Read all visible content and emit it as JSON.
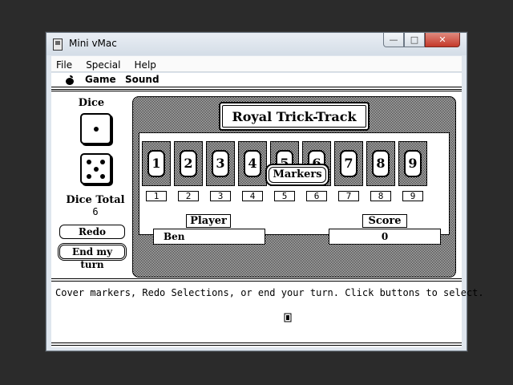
{
  "host_window": {
    "title": "Mini vMac",
    "menu": [
      "File",
      "Special",
      "Help"
    ],
    "controls": {
      "minimize": "—",
      "maximize": "□",
      "close": "✕"
    }
  },
  "mac_menu": {
    "items": [
      "Game",
      "Sound"
    ]
  },
  "dice": {
    "title": "Dice",
    "die1": 1,
    "die2": 5,
    "total_label": "Dice Total",
    "total_value": "6"
  },
  "buttons": {
    "redo": "Redo",
    "end_turn": "End my turn"
  },
  "board": {
    "title": "Royal Trick-Track",
    "tiles": [
      "1",
      "2",
      "3",
      "4",
      "5",
      "6",
      "7",
      "8",
      "9"
    ],
    "markers_label": "Markers"
  },
  "scoreboard": {
    "player_header": "Player",
    "score_header": "Score",
    "player_name": "Ben",
    "score_value": "0"
  },
  "status": {
    "message": "Cover markers, Redo Selections, or end your turn.  Click buttons to select."
  }
}
